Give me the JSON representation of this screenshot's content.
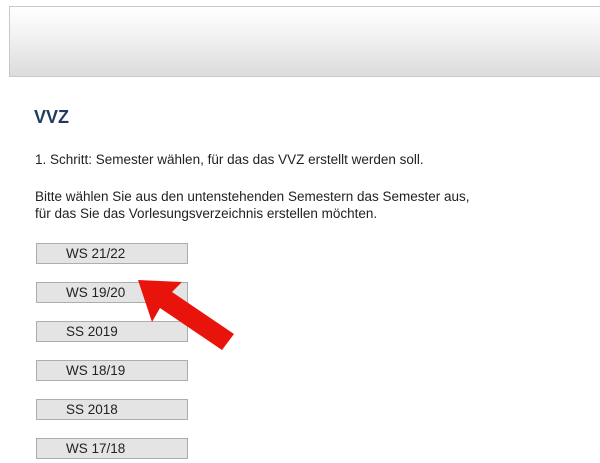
{
  "page": {
    "title": "VVZ",
    "step_label": "1. Schritt: Semester wählen, für das das VVZ erstellt werden soll.",
    "intro_line1": "Bitte wählen Sie aus den untenstehenden Semestern das Semester aus,",
    "intro_line2": "für das Sie das Vorlesungsverzeichnis erstellen möchten."
  },
  "semesters": [
    {
      "label": "WS 21/22"
    },
    {
      "label": "WS 19/20"
    },
    {
      "label": "SS 2019"
    },
    {
      "label": "WS 18/19"
    },
    {
      "label": "SS 2018"
    },
    {
      "label": "WS 17/18"
    }
  ],
  "annotation": {
    "icon": "red-arrow-icon",
    "color": "#e8140c",
    "points_to": "WS 19/20"
  },
  "colors": {
    "title": "#1f3b5f",
    "button_bg": "#e4e4e4",
    "button_border": "#adadad"
  }
}
